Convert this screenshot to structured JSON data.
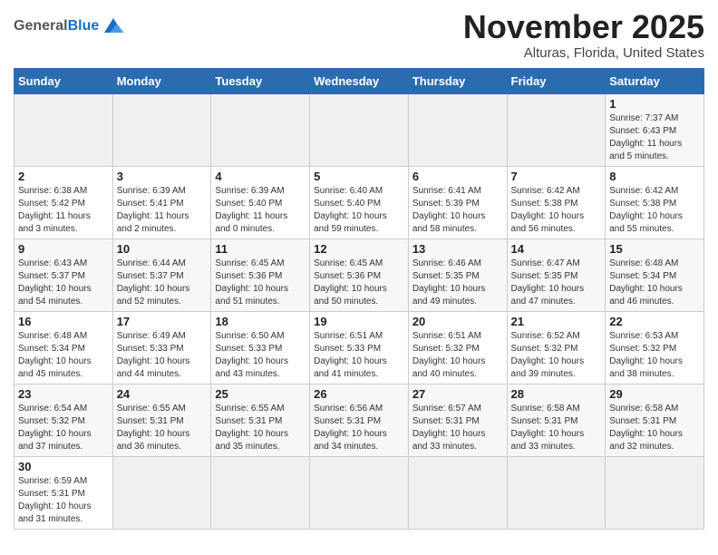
{
  "logo": {
    "general": "General",
    "blue": "Blue"
  },
  "header": {
    "month": "November 2025",
    "location": "Alturas, Florida, United States"
  },
  "days_of_week": [
    "Sunday",
    "Monday",
    "Tuesday",
    "Wednesday",
    "Thursday",
    "Friday",
    "Saturday"
  ],
  "weeks": [
    [
      {
        "day": "",
        "info": ""
      },
      {
        "day": "",
        "info": ""
      },
      {
        "day": "",
        "info": ""
      },
      {
        "day": "",
        "info": ""
      },
      {
        "day": "",
        "info": ""
      },
      {
        "day": "",
        "info": ""
      },
      {
        "day": "1",
        "info": "Sunrise: 7:37 AM\nSunset: 6:43 PM\nDaylight: 11 hours\nand 5 minutes."
      }
    ],
    [
      {
        "day": "2",
        "info": "Sunrise: 6:38 AM\nSunset: 5:42 PM\nDaylight: 11 hours\nand 3 minutes."
      },
      {
        "day": "3",
        "info": "Sunrise: 6:39 AM\nSunset: 5:41 PM\nDaylight: 11 hours\nand 2 minutes."
      },
      {
        "day": "4",
        "info": "Sunrise: 6:39 AM\nSunset: 5:40 PM\nDaylight: 11 hours\nand 0 minutes."
      },
      {
        "day": "5",
        "info": "Sunrise: 6:40 AM\nSunset: 5:40 PM\nDaylight: 10 hours\nand 59 minutes."
      },
      {
        "day": "6",
        "info": "Sunrise: 6:41 AM\nSunset: 5:39 PM\nDaylight: 10 hours\nand 58 minutes."
      },
      {
        "day": "7",
        "info": "Sunrise: 6:42 AM\nSunset: 5:38 PM\nDaylight: 10 hours\nand 56 minutes."
      },
      {
        "day": "8",
        "info": "Sunrise: 6:42 AM\nSunset: 5:38 PM\nDaylight: 10 hours\nand 55 minutes."
      }
    ],
    [
      {
        "day": "9",
        "info": "Sunrise: 6:43 AM\nSunset: 5:37 PM\nDaylight: 10 hours\nand 54 minutes."
      },
      {
        "day": "10",
        "info": "Sunrise: 6:44 AM\nSunset: 5:37 PM\nDaylight: 10 hours\nand 52 minutes."
      },
      {
        "day": "11",
        "info": "Sunrise: 6:45 AM\nSunset: 5:36 PM\nDaylight: 10 hours\nand 51 minutes."
      },
      {
        "day": "12",
        "info": "Sunrise: 6:45 AM\nSunset: 5:36 PM\nDaylight: 10 hours\nand 50 minutes."
      },
      {
        "day": "13",
        "info": "Sunrise: 6:46 AM\nSunset: 5:35 PM\nDaylight: 10 hours\nand 49 minutes."
      },
      {
        "day": "14",
        "info": "Sunrise: 6:47 AM\nSunset: 5:35 PM\nDaylight: 10 hours\nand 47 minutes."
      },
      {
        "day": "15",
        "info": "Sunrise: 6:48 AM\nSunset: 5:34 PM\nDaylight: 10 hours\nand 46 minutes."
      }
    ],
    [
      {
        "day": "16",
        "info": "Sunrise: 6:48 AM\nSunset: 5:34 PM\nDaylight: 10 hours\nand 45 minutes."
      },
      {
        "day": "17",
        "info": "Sunrise: 6:49 AM\nSunset: 5:33 PM\nDaylight: 10 hours\nand 44 minutes."
      },
      {
        "day": "18",
        "info": "Sunrise: 6:50 AM\nSunset: 5:33 PM\nDaylight: 10 hours\nand 43 minutes."
      },
      {
        "day": "19",
        "info": "Sunrise: 6:51 AM\nSunset: 5:33 PM\nDaylight: 10 hours\nand 41 minutes."
      },
      {
        "day": "20",
        "info": "Sunrise: 6:51 AM\nSunset: 5:32 PM\nDaylight: 10 hours\nand 40 minutes."
      },
      {
        "day": "21",
        "info": "Sunrise: 6:52 AM\nSunset: 5:32 PM\nDaylight: 10 hours\nand 39 minutes."
      },
      {
        "day": "22",
        "info": "Sunrise: 6:53 AM\nSunset: 5:32 PM\nDaylight: 10 hours\nand 38 minutes."
      }
    ],
    [
      {
        "day": "23",
        "info": "Sunrise: 6:54 AM\nSunset: 5:32 PM\nDaylight: 10 hours\nand 37 minutes."
      },
      {
        "day": "24",
        "info": "Sunrise: 6:55 AM\nSunset: 5:31 PM\nDaylight: 10 hours\nand 36 minutes."
      },
      {
        "day": "25",
        "info": "Sunrise: 6:55 AM\nSunset: 5:31 PM\nDaylight: 10 hours\nand 35 minutes."
      },
      {
        "day": "26",
        "info": "Sunrise: 6:56 AM\nSunset: 5:31 PM\nDaylight: 10 hours\nand 34 minutes."
      },
      {
        "day": "27",
        "info": "Sunrise: 6:57 AM\nSunset: 5:31 PM\nDaylight: 10 hours\nand 33 minutes."
      },
      {
        "day": "28",
        "info": "Sunrise: 6:58 AM\nSunset: 5:31 PM\nDaylight: 10 hours\nand 33 minutes."
      },
      {
        "day": "29",
        "info": "Sunrise: 6:58 AM\nSunset: 5:31 PM\nDaylight: 10 hours\nand 32 minutes."
      }
    ],
    [
      {
        "day": "30",
        "info": "Sunrise: 6:59 AM\nSunset: 5:31 PM\nDaylight: 10 hours\nand 31 minutes."
      },
      {
        "day": "",
        "info": ""
      },
      {
        "day": "",
        "info": ""
      },
      {
        "day": "",
        "info": ""
      },
      {
        "day": "",
        "info": ""
      },
      {
        "day": "",
        "info": ""
      },
      {
        "day": "",
        "info": ""
      }
    ]
  ]
}
